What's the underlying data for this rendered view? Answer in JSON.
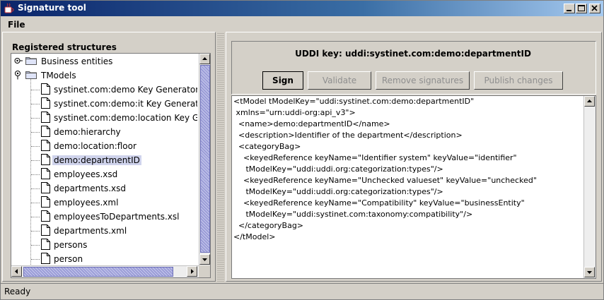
{
  "window": {
    "title": "Signature tool"
  },
  "menu": {
    "file": "File"
  },
  "left": {
    "heading": "Registered structures",
    "tree": [
      {
        "label": "Business entities",
        "type": "folder",
        "level": 0,
        "expanded": false
      },
      {
        "label": "TModels",
        "type": "folder",
        "level": 0,
        "expanded": true
      },
      {
        "label": "systinet.com:demo Key Generator",
        "type": "doc",
        "level": 1
      },
      {
        "label": "systinet.com:demo:it Key Generator",
        "type": "doc",
        "level": 1
      },
      {
        "label": "systinet.com:demo:location Key Gene",
        "type": "doc",
        "level": 1
      },
      {
        "label": "demo:hierarchy",
        "type": "doc",
        "level": 1
      },
      {
        "label": "demo:location:floor",
        "type": "doc",
        "level": 1
      },
      {
        "label": "demo:departmentID",
        "type": "doc",
        "level": 1,
        "selected": true
      },
      {
        "label": "employees.xsd",
        "type": "doc",
        "level": 1
      },
      {
        "label": "departments.xsd",
        "type": "doc",
        "level": 1
      },
      {
        "label": "employees.xml",
        "type": "doc",
        "level": 1
      },
      {
        "label": "employeesToDepartments.xsl",
        "type": "doc",
        "level": 1
      },
      {
        "label": "departments.xml",
        "type": "doc",
        "level": 1
      },
      {
        "label": "persons",
        "type": "doc",
        "level": 1
      },
      {
        "label": "person",
        "type": "doc",
        "level": 1
      }
    ]
  },
  "right": {
    "uddi_key": "UDDI key:  uddi:systinet.com:demo:departmentID",
    "buttons": {
      "sign": "Sign",
      "validate": "Validate",
      "remove_signatures": "Remove signatures",
      "publish_changes": "Publish changes"
    },
    "xml": "<tModel tModelKey=\"uddi:systinet.com:demo:departmentID\"\n xmlns=\"urn:uddi-org:api_v3\">\n  <name>demo:departmentID</name>\n  <description>Identifier of the department</description>\n  <categoryBag>\n    <keyedReference keyName=\"Identifier system\" keyValue=\"identifier\"\n     tModelKey=\"uddi:uddi.org:categorization:types\"/>\n    <keyedReference keyName=\"Unchecked valueset\" keyValue=\"unchecked\"\n     tModelKey=\"uddi:uddi.org:categorization:types\"/>\n    <keyedReference keyName=\"Compatibility\" keyValue=\"businessEntity\"\n     tModelKey=\"uddi:systinet.com:taxonomy:compatibility\"/>\n  </categoryBag>\n</tModel>"
  },
  "status": {
    "text": "Ready"
  },
  "icons": {
    "app": "java-coffee-icon",
    "folder": "folder-icon",
    "document": "document-icon",
    "expand": "tree-expand-icon",
    "collapse": "tree-collapse-icon"
  },
  "colors": {
    "title_start": "#0a246a",
    "title_end": "#a6caf0",
    "selection": "#cfd3ec",
    "scroll_thumb": "#8d8fd0"
  }
}
